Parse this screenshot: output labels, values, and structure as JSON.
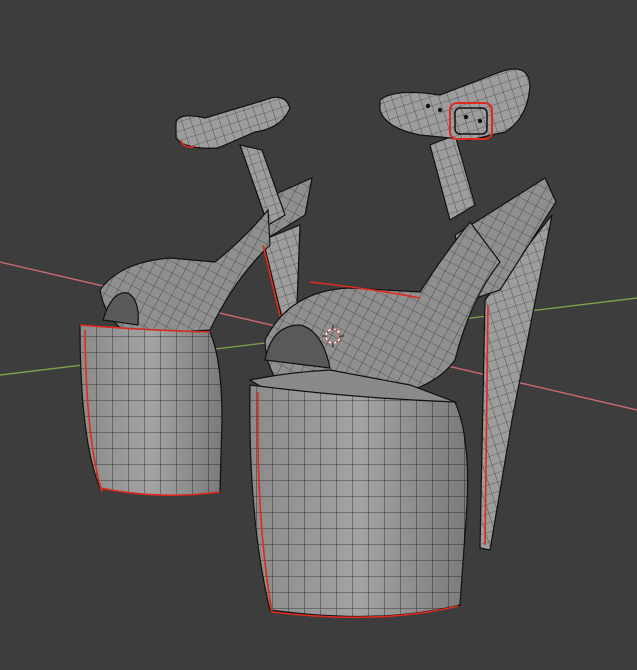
{
  "viewport": {
    "background": "#3d3d3d",
    "axis_x_color": "#7aa04a",
    "axis_y_color": "#c76a6e",
    "mesh_color": "#9a9a9a",
    "wire_color": "#1a1a1a",
    "seam_color": "#e02a20",
    "objects": [
      "left-shoe-mesh",
      "right-shoe-mesh"
    ],
    "cursor": "3d-cursor-icon"
  }
}
